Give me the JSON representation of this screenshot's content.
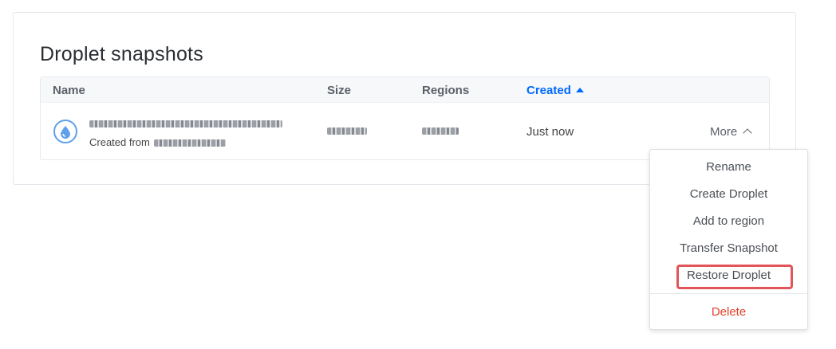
{
  "page": {
    "title": "Droplet snapshots"
  },
  "table": {
    "headers": {
      "name": "Name",
      "size": "Size",
      "regions": "Regions",
      "created": "Created"
    },
    "rows": [
      {
        "created_from_label": "Created from",
        "created": "Just now",
        "more_label": "More"
      }
    ]
  },
  "menu": {
    "items": [
      "Rename",
      "Create Droplet",
      "Add to region",
      "Transfer Snapshot",
      "Restore Droplet"
    ],
    "delete_label": "Delete"
  },
  "colors": {
    "accent": "#0069ff",
    "danger": "#e0432c",
    "highlight": "#e25559"
  }
}
